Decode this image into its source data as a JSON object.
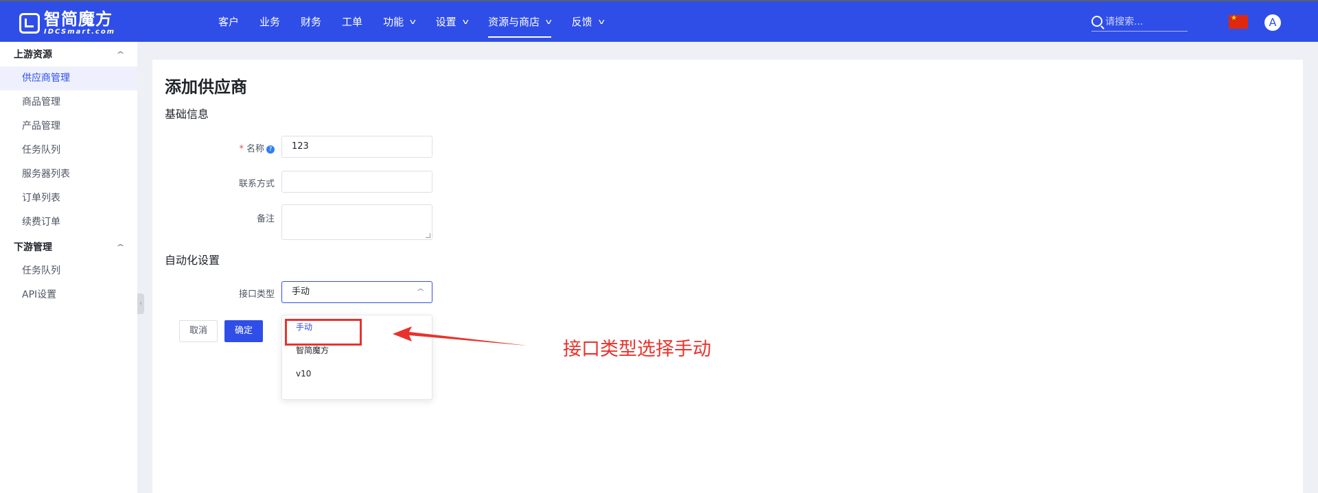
{
  "app": {
    "logo_main": "智简魔方",
    "logo_sub": "IDCSmart.com"
  },
  "nav": {
    "items": [
      {
        "label": "客户",
        "has_dropdown": false
      },
      {
        "label": "业务",
        "has_dropdown": false
      },
      {
        "label": "财务",
        "has_dropdown": false
      },
      {
        "label": "工单",
        "has_dropdown": false
      },
      {
        "label": "功能",
        "has_dropdown": true
      },
      {
        "label": "设置",
        "has_dropdown": true
      },
      {
        "label": "资源与商店",
        "has_dropdown": true,
        "active": true
      },
      {
        "label": "反馈",
        "has_dropdown": true
      }
    ],
    "search_placeholder": "请搜索...",
    "avatar_letter": "A"
  },
  "sidebar": {
    "groups": [
      {
        "title": "上游资源",
        "items": [
          "供应商管理",
          "商品管理",
          "产品管理",
          "任务队列",
          "服务器列表",
          "订单列表",
          "续费订单"
        ],
        "active": "供应商管理"
      },
      {
        "title": "下游管理",
        "items": [
          "任务队列",
          "API设置"
        ]
      }
    ]
  },
  "page": {
    "title": "添加供应商",
    "basic_section": "基础信息",
    "name_label": "名称",
    "name_value": "123",
    "contact_label": "联系方式",
    "contact_value": "",
    "notes_label": "备注",
    "notes_value": "",
    "auto_section": "自动化设置",
    "api_type_label": "接口类型",
    "api_type_value": "手动",
    "api_type_options": [
      "手动",
      "智简魔方",
      "v10"
    ],
    "cancel_label": "取消",
    "ok_label": "确定"
  },
  "annotation": {
    "text": "接口类型选择手动",
    "color": "#e8322b"
  },
  "colors": {
    "brand": "#2f4ee8",
    "required": "#e34d59"
  }
}
